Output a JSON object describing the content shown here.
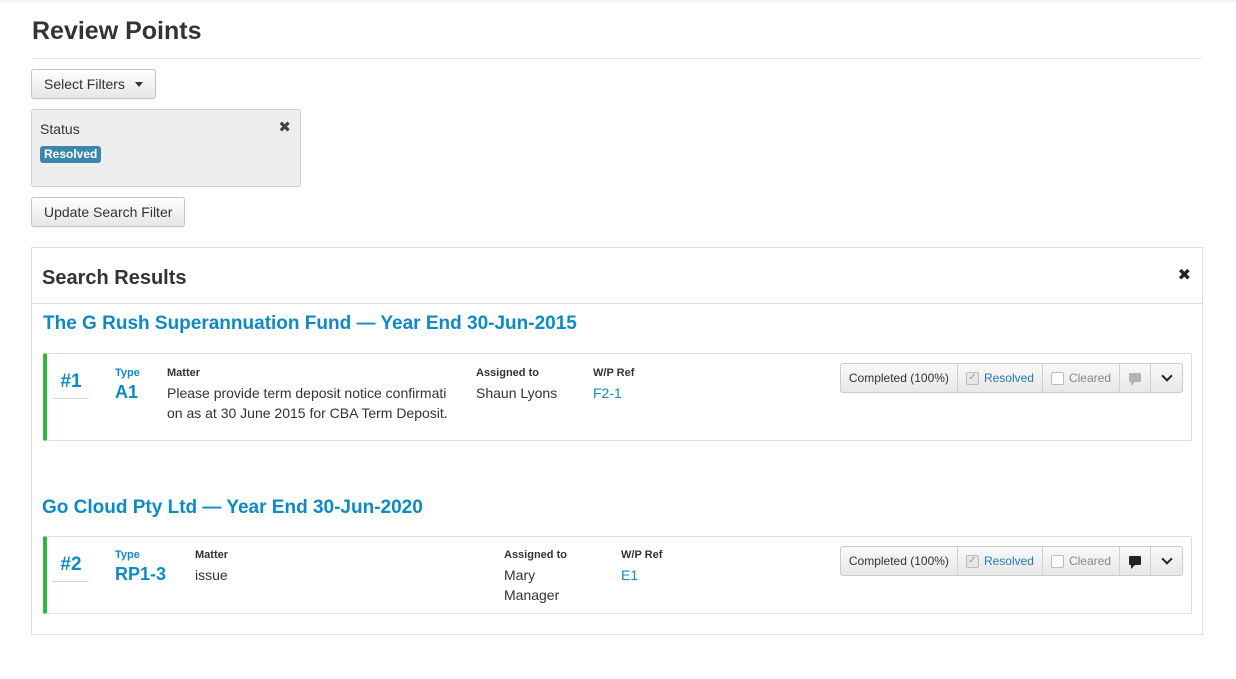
{
  "page": {
    "title": "Review Points"
  },
  "filters": {
    "select_label": "Select Filters",
    "active": {
      "label": "Status",
      "value": "Resolved"
    },
    "update_label": "Update Search Filter"
  },
  "results": {
    "title": "Search Results",
    "groups": [
      {
        "title": "The G Rush Superannuation Fund — Year End 30-Jun-2015",
        "points": [
          {
            "number": "#1",
            "type_label": "Type",
            "type": "A1",
            "matter_label": "Matter",
            "matter_lines": [
              "Please provide term deposit notice confirmati",
              "on as at 30 June 2015 for CBA Term Deposit."
            ],
            "assigned_label": "Assigned to",
            "assigned_lines": [
              "Shaun Lyons"
            ],
            "wp_label": "W/P Ref",
            "wp_ref": "F2-1",
            "status": {
              "completed": "Completed (100%)",
              "resolved": "Resolved",
              "cleared": "Cleared",
              "resolved_checked": true,
              "cleared_checked": false,
              "has_comments": false
            }
          }
        ]
      },
      {
        "title": "Go Cloud Pty Ltd — Year End 30-Jun-2020",
        "points": [
          {
            "number": "#2",
            "type_label": "Type",
            "type": "RP1-3",
            "matter_label": "Matter",
            "matter_lines": [
              "issue"
            ],
            "assigned_label": "Assigned to",
            "assigned_lines": [
              "Mary",
              "Manager"
            ],
            "wp_label": "W/P Ref",
            "wp_ref": "E1",
            "status": {
              "completed": "Completed (100%)",
              "resolved": "Resolved",
              "cleared": "Cleared",
              "resolved_checked": true,
              "cleared_checked": false,
              "has_comments": true
            }
          }
        ]
      }
    ]
  },
  "colors": {
    "link": "#0d8ac6",
    "badge": "#3a87ad",
    "accent_bar": "#2db83d"
  },
  "icons": {
    "close": "close-icon",
    "caret": "caret-down-icon",
    "comment": "comment-icon",
    "expand": "chevron-down-icon",
    "check": "checkbox-icon"
  }
}
